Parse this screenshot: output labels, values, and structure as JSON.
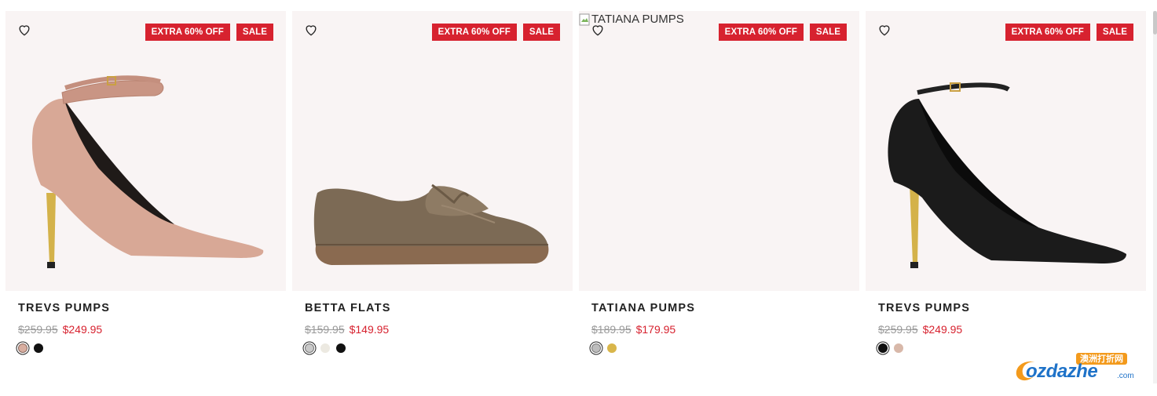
{
  "products": [
    {
      "name": "TREVS PUMPS",
      "was_price": "$259.95",
      "now_price": "$249.95",
      "badges": [
        "EXTRA 60% OFF",
        "SALE"
      ],
      "image_alt": "",
      "swatches": [
        {
          "color": "#d8aea0",
          "selected": true,
          "label": "blush"
        },
        {
          "color": "#111111",
          "selected": false,
          "label": "black"
        }
      ]
    },
    {
      "name": "BETTA FLATS",
      "was_price": "$159.95",
      "now_price": "$149.95",
      "badges": [
        "EXTRA 60% OFF",
        "SALE"
      ],
      "image_alt": "",
      "swatches": [
        {
          "color": "#c9c9c9",
          "selected": true,
          "label": "grey"
        },
        {
          "color": "#ece9e1",
          "selected": false,
          "label": "cream"
        },
        {
          "color": "#111111",
          "selected": false,
          "label": "black"
        }
      ]
    },
    {
      "name": "TATIANA PUMPS",
      "was_price": "$189.95",
      "now_price": "$179.95",
      "badges": [
        "EXTRA 60% OFF",
        "SALE"
      ],
      "image_alt": "TATIANA PUMPS",
      "swatches": [
        {
          "color": "#bdbdbd",
          "selected": true,
          "label": "silver"
        },
        {
          "color": "#d9b64a",
          "selected": false,
          "label": "gold"
        }
      ]
    },
    {
      "name": "TREVS PUMPS",
      "was_price": "$259.95",
      "now_price": "$249.95",
      "badges": [
        "EXTRA 60% OFF",
        "SALE"
      ],
      "image_alt": "",
      "swatches": [
        {
          "color": "#111111",
          "selected": true,
          "label": "black"
        },
        {
          "color": "#d8b8a9",
          "selected": false,
          "label": "blush"
        }
      ]
    }
  ],
  "watermark": {
    "brand": "ozdazhe",
    "suffix": ".com",
    "tag": "澳洲打折网"
  },
  "colors": {
    "badge": "#d7222f",
    "sale_price": "#d7222f",
    "tile_bg": "#f9f4f4"
  }
}
